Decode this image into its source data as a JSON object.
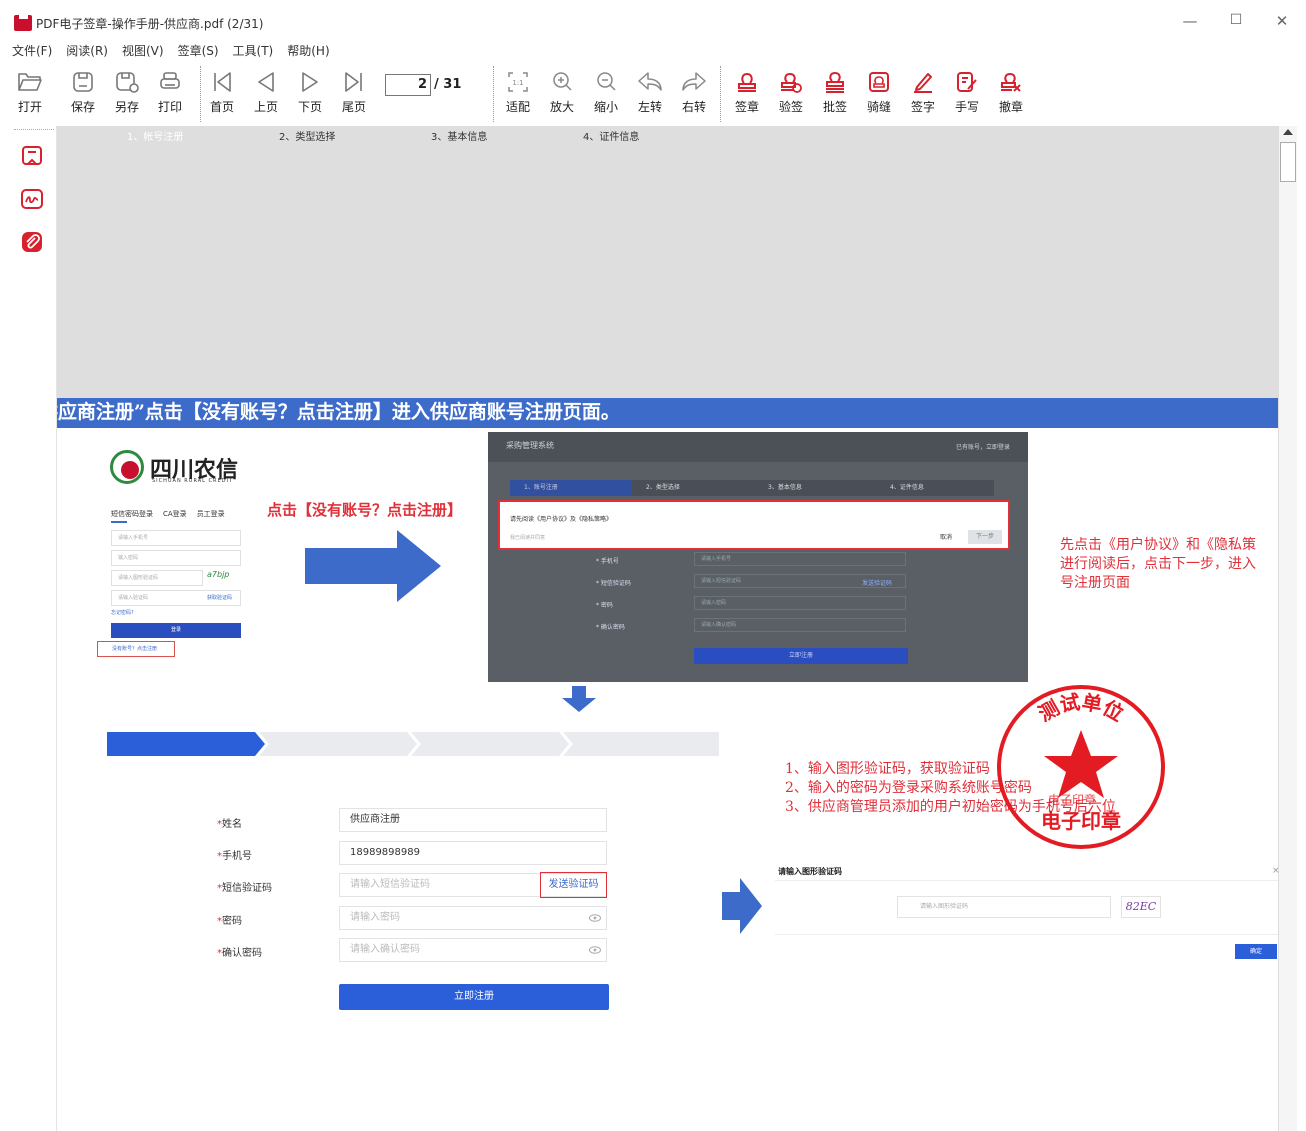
{
  "window": {
    "title": "PDF电子签章-操作手册-供应商.pdf (2/31)",
    "minimize": "—",
    "maximize": "☐",
    "close": "✕"
  },
  "menu": [
    "文件(F)",
    "阅读(R)",
    "视图(V)",
    "签章(S)",
    "工具(T)",
    "帮助(H)"
  ],
  "toolbar": {
    "open": "打开",
    "save": "保存",
    "save_as": "另存",
    "print": "打印",
    "first": "首页",
    "prev": "上页",
    "next": "下页",
    "last": "尾页",
    "page_current": "2",
    "page_total": "/ 31",
    "fit": "适配",
    "zoom_in": "放大",
    "zoom_out": "缩小",
    "rotate_left": "左转",
    "rotate_right": "右转",
    "stamp": "签章",
    "verify": "验签",
    "batch": "批签",
    "seam": "骑缝",
    "sign": "签字",
    "handwrite": "手写",
    "revoke": "撤章"
  },
  "doc": {
    "banner": "供应商注册”点击【没有账号？点击注册】进入供应商账号注册页面。",
    "logo": {
      "name": "四川农信",
      "sub": "SICHUAN RURAL CREDIT"
    },
    "mini_login": {
      "tabs": [
        "短信密码登录",
        "CA登录",
        "员工登录"
      ],
      "phone_ph": "请输入手机号",
      "pwd_ph": "输入密码",
      "captcha_ph": "请输入图形验证码",
      "captcha_img": "a7bjp",
      "sms_ph": "请输入验证码",
      "sms_btn": "获取验证码",
      "forgot": "忘记密码?",
      "login": "登录",
      "register": "没有账号？点击注册"
    },
    "callout_click": "点击【没有账号？点击注册】",
    "modal_shot": {
      "system": "采购管理系统",
      "have_account": "已有账号，立即登录",
      "steps": [
        "1、账号注册",
        "2、类型选择",
        "3、基本信息",
        "4、证件信息"
      ],
      "read_prompt": "请先阅读《用户协议》及《隐私策略》",
      "agree_check": "我已阅读并同意",
      "cancel": "取消",
      "next": "下一步",
      "rows": [
        "* 手机号",
        "* 短信验证码",
        "* 密码",
        "* 确认密码"
      ],
      "row_ph": [
        "请输入手机号",
        "请输入短信验证码",
        "请输入密码",
        "请输入确认密码"
      ],
      "sms": "发送验证码",
      "submit": "立即注册"
    },
    "callout_right": [
      "先点击《用户协议》和《隐私策",
      "进行阅读后，点击下一步，进入",
      "号注册页面"
    ],
    "steps": [
      "1、帐号注册",
      "2、类型选择",
      "3、基本信息",
      "4、证件信息"
    ],
    "form": {
      "name_label": "姓名",
      "name_value": "供应商注册",
      "phone_label": "手机号",
      "phone_value": "18989898989",
      "sms_label": "短信验证码",
      "sms_ph": "请输入短信验证码",
      "sms_btn": "发送验证码",
      "pwd_label": "密码",
      "pwd_ph": "请输入密码",
      "confirm_label": "确认密码",
      "confirm_ph": "请输入确认密码",
      "submit": "立即注册"
    },
    "notes": [
      "1、输入图形验证码，获取验证码",
      "2、输入的密码为登录采购系统账号密码",
      "3、供应商管理员添加的用户初始密码为手机号后六位"
    ],
    "captcha_dialog": {
      "title": "请输入图形验证码",
      "close": "×",
      "placeholder": "请输入图形验证码",
      "code": "82EC",
      "ok": "确定"
    },
    "seal": {
      "top": "测试单位",
      "bottom": "电子印章",
      "overlay": "电子印章"
    }
  },
  "colors": {
    "accent_red": "#e0303a",
    "banner_blue": "#3c6bc9",
    "seal_red": "#e31b23"
  }
}
